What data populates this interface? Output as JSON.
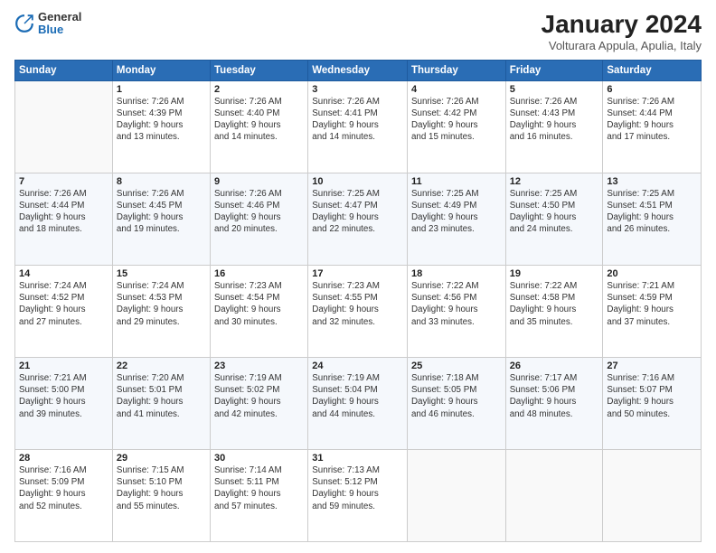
{
  "logo": {
    "general": "General",
    "blue": "Blue"
  },
  "title": "January 2024",
  "subtitle": "Volturara Appula, Apulia, Italy",
  "days_header": [
    "Sunday",
    "Monday",
    "Tuesday",
    "Wednesday",
    "Thursday",
    "Friday",
    "Saturday"
  ],
  "weeks": [
    [
      {
        "num": "",
        "info": ""
      },
      {
        "num": "1",
        "info": "Sunrise: 7:26 AM\nSunset: 4:39 PM\nDaylight: 9 hours\nand 13 minutes."
      },
      {
        "num": "2",
        "info": "Sunrise: 7:26 AM\nSunset: 4:40 PM\nDaylight: 9 hours\nand 14 minutes."
      },
      {
        "num": "3",
        "info": "Sunrise: 7:26 AM\nSunset: 4:41 PM\nDaylight: 9 hours\nand 14 minutes."
      },
      {
        "num": "4",
        "info": "Sunrise: 7:26 AM\nSunset: 4:42 PM\nDaylight: 9 hours\nand 15 minutes."
      },
      {
        "num": "5",
        "info": "Sunrise: 7:26 AM\nSunset: 4:43 PM\nDaylight: 9 hours\nand 16 minutes."
      },
      {
        "num": "6",
        "info": "Sunrise: 7:26 AM\nSunset: 4:44 PM\nDaylight: 9 hours\nand 17 minutes."
      }
    ],
    [
      {
        "num": "7",
        "info": "Sunrise: 7:26 AM\nSunset: 4:44 PM\nDaylight: 9 hours\nand 18 minutes."
      },
      {
        "num": "8",
        "info": "Sunrise: 7:26 AM\nSunset: 4:45 PM\nDaylight: 9 hours\nand 19 minutes."
      },
      {
        "num": "9",
        "info": "Sunrise: 7:26 AM\nSunset: 4:46 PM\nDaylight: 9 hours\nand 20 minutes."
      },
      {
        "num": "10",
        "info": "Sunrise: 7:25 AM\nSunset: 4:47 PM\nDaylight: 9 hours\nand 22 minutes."
      },
      {
        "num": "11",
        "info": "Sunrise: 7:25 AM\nSunset: 4:49 PM\nDaylight: 9 hours\nand 23 minutes."
      },
      {
        "num": "12",
        "info": "Sunrise: 7:25 AM\nSunset: 4:50 PM\nDaylight: 9 hours\nand 24 minutes."
      },
      {
        "num": "13",
        "info": "Sunrise: 7:25 AM\nSunset: 4:51 PM\nDaylight: 9 hours\nand 26 minutes."
      }
    ],
    [
      {
        "num": "14",
        "info": "Sunrise: 7:24 AM\nSunset: 4:52 PM\nDaylight: 9 hours\nand 27 minutes."
      },
      {
        "num": "15",
        "info": "Sunrise: 7:24 AM\nSunset: 4:53 PM\nDaylight: 9 hours\nand 29 minutes."
      },
      {
        "num": "16",
        "info": "Sunrise: 7:23 AM\nSunset: 4:54 PM\nDaylight: 9 hours\nand 30 minutes."
      },
      {
        "num": "17",
        "info": "Sunrise: 7:23 AM\nSunset: 4:55 PM\nDaylight: 9 hours\nand 32 minutes."
      },
      {
        "num": "18",
        "info": "Sunrise: 7:22 AM\nSunset: 4:56 PM\nDaylight: 9 hours\nand 33 minutes."
      },
      {
        "num": "19",
        "info": "Sunrise: 7:22 AM\nSunset: 4:58 PM\nDaylight: 9 hours\nand 35 minutes."
      },
      {
        "num": "20",
        "info": "Sunrise: 7:21 AM\nSunset: 4:59 PM\nDaylight: 9 hours\nand 37 minutes."
      }
    ],
    [
      {
        "num": "21",
        "info": "Sunrise: 7:21 AM\nSunset: 5:00 PM\nDaylight: 9 hours\nand 39 minutes."
      },
      {
        "num": "22",
        "info": "Sunrise: 7:20 AM\nSunset: 5:01 PM\nDaylight: 9 hours\nand 41 minutes."
      },
      {
        "num": "23",
        "info": "Sunrise: 7:19 AM\nSunset: 5:02 PM\nDaylight: 9 hours\nand 42 minutes."
      },
      {
        "num": "24",
        "info": "Sunrise: 7:19 AM\nSunset: 5:04 PM\nDaylight: 9 hours\nand 44 minutes."
      },
      {
        "num": "25",
        "info": "Sunrise: 7:18 AM\nSunset: 5:05 PM\nDaylight: 9 hours\nand 46 minutes."
      },
      {
        "num": "26",
        "info": "Sunrise: 7:17 AM\nSunset: 5:06 PM\nDaylight: 9 hours\nand 48 minutes."
      },
      {
        "num": "27",
        "info": "Sunrise: 7:16 AM\nSunset: 5:07 PM\nDaylight: 9 hours\nand 50 minutes."
      }
    ],
    [
      {
        "num": "28",
        "info": "Sunrise: 7:16 AM\nSunset: 5:09 PM\nDaylight: 9 hours\nand 52 minutes."
      },
      {
        "num": "29",
        "info": "Sunrise: 7:15 AM\nSunset: 5:10 PM\nDaylight: 9 hours\nand 55 minutes."
      },
      {
        "num": "30",
        "info": "Sunrise: 7:14 AM\nSunset: 5:11 PM\nDaylight: 9 hours\nand 57 minutes."
      },
      {
        "num": "31",
        "info": "Sunrise: 7:13 AM\nSunset: 5:12 PM\nDaylight: 9 hours\nand 59 minutes."
      },
      {
        "num": "",
        "info": ""
      },
      {
        "num": "",
        "info": ""
      },
      {
        "num": "",
        "info": ""
      }
    ]
  ]
}
